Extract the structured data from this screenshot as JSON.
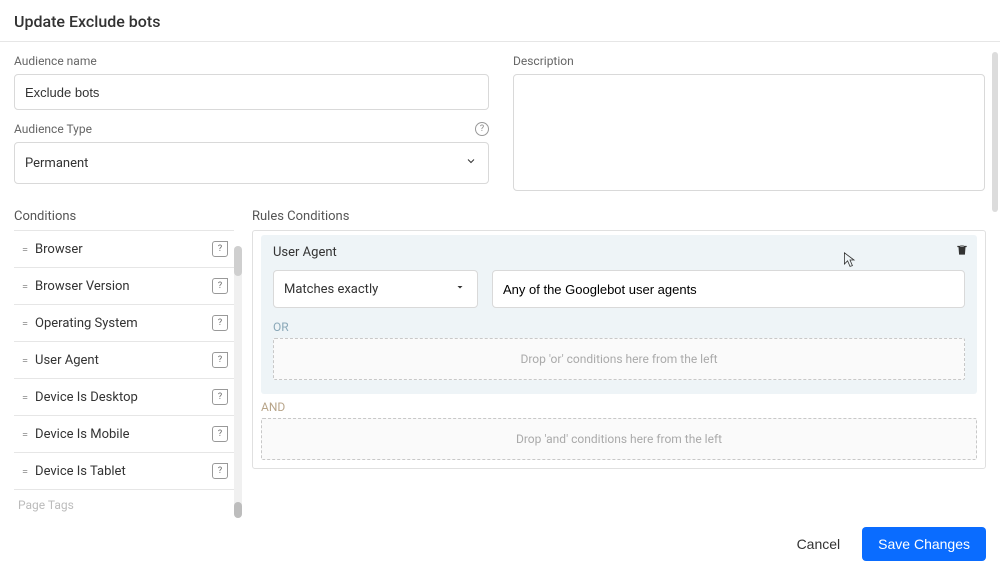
{
  "header": {
    "title": "Update Exclude bots"
  },
  "fields": {
    "audience_name_label": "Audience name",
    "audience_name_value": "Exclude bots",
    "audience_type_label": "Audience Type",
    "audience_type_value": "Permanent",
    "description_label": "Description",
    "description_value": ""
  },
  "conditions": {
    "title": "Conditions",
    "items": [
      "Browser",
      "Browser Version",
      "Operating System",
      "User Agent",
      "Device Is Desktop",
      "Device Is Mobile",
      "Device Is Tablet"
    ],
    "page_tags_hint": "Page Tags"
  },
  "rules": {
    "title": "Rules Conditions",
    "card_title": "User Agent",
    "match_operator": "Matches exactly",
    "match_value": "Any of the Googlebot user agents",
    "or_label": "OR",
    "or_drop_hint": "Drop 'or' conditions here from the left",
    "and_label": "AND",
    "and_drop_hint": "Drop 'and' conditions here from the left"
  },
  "footer": {
    "cancel": "Cancel",
    "save": "Save Changes"
  }
}
